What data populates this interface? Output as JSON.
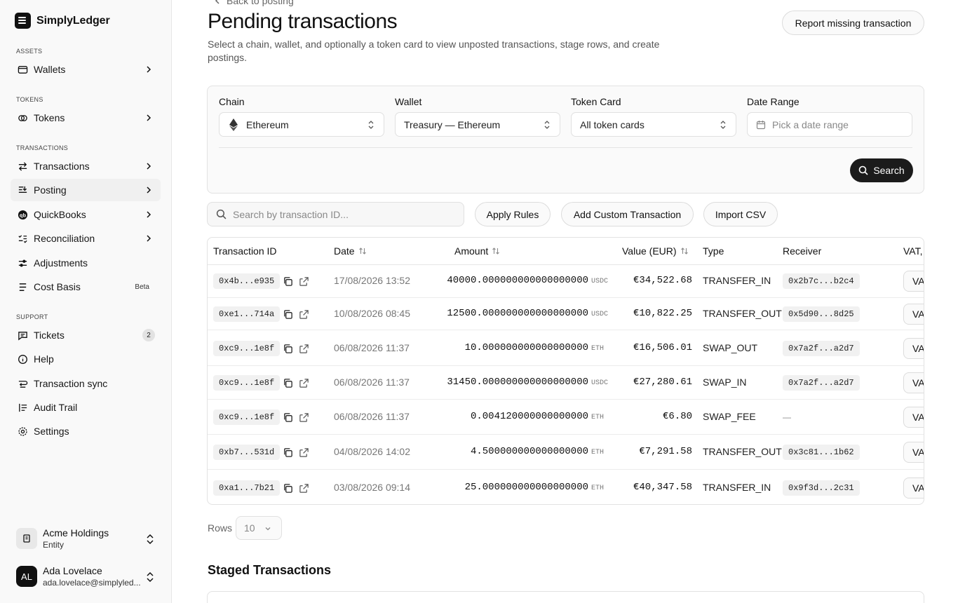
{
  "brand": {
    "name": "SimplyLedger"
  },
  "sidebar": {
    "sections": {
      "assets": "ASSETS",
      "tokens": "TOKENS",
      "transactions": "TRANSACTIONS",
      "support": "SUPPORT"
    },
    "items": {
      "wallets": "Wallets",
      "tokens": "Tokens",
      "transactions": "Transactions",
      "posting": "Posting",
      "quickbooks": "QuickBooks",
      "reconciliation": "Reconciliation",
      "adjustments": "Adjustments",
      "cost_basis": "Cost Basis",
      "cost_basis_badge": "Beta",
      "tickets": "Tickets",
      "tickets_count": "2",
      "help": "Help",
      "transaction_sync": "Transaction sync",
      "audit_trail": "Audit Trail",
      "settings": "Settings"
    },
    "entity": {
      "name": "Acme Holdings",
      "sub": "Entity"
    },
    "user": {
      "initials": "AL",
      "name": "Ada Lovelace",
      "email": "ada.lovelace@simplyled..."
    }
  },
  "header": {
    "back": "Back to posting",
    "title": "Pending transactions",
    "subtitle": "Select a chain, wallet, and optionally a token card to view unposted transactions, stage rows, and create postings.",
    "report_button": "Report missing transaction"
  },
  "filters": {
    "chain_label": "Chain",
    "chain_value": "Ethereum",
    "wallet_label": "Wallet",
    "wallet_value": "Treasury — Ethereum",
    "token_label": "Token Card",
    "token_value": "All token cards",
    "date_label": "Date Range",
    "date_placeholder": "Pick a date range",
    "search_button": "Search"
  },
  "toolbar": {
    "search_placeholder": "Search by transaction ID...",
    "apply_rules": "Apply Rules",
    "add_custom": "Add Custom Transaction",
    "import_csv": "Import CSV"
  },
  "table": {
    "headers": {
      "txid": "Transaction ID",
      "date": "Date",
      "amount": "Amount",
      "value": "Value (EUR)",
      "type": "Type",
      "receiver": "Receiver",
      "vat": "VAT,"
    },
    "rows": [
      {
        "txid": "0x4b...e935",
        "date": "17/08/2026 13:52",
        "amount": "40000.000000000000000000",
        "unit": "USDC",
        "value": "€34,522.68",
        "type": "TRANSFER_IN",
        "receiver": "0x2b7c...b2c4",
        "vat": "VA"
      },
      {
        "txid": "0xe1...714a",
        "date": "10/08/2026 08:45",
        "amount": "12500.000000000000000000",
        "unit": "USDC",
        "value": "€10,822.25",
        "type": "TRANSFER_OUT",
        "receiver": "0x5d90...8d25",
        "vat": "VA"
      },
      {
        "txid": "0xc9...1e8f",
        "date": "06/08/2026 11:37",
        "amount": "10.000000000000000000",
        "unit": "ETH",
        "value": "€16,506.01",
        "type": "SWAP_OUT",
        "receiver": "0x7a2f...a2d7",
        "vat": "VA"
      },
      {
        "txid": "0xc9...1e8f",
        "date": "06/08/2026 11:37",
        "amount": "31450.000000000000000000",
        "unit": "USDC",
        "value": "€27,280.61",
        "type": "SWAP_IN",
        "receiver": "0x7a2f...a2d7",
        "vat": "VA"
      },
      {
        "txid": "0xc9...1e8f",
        "date": "06/08/2026 11:37",
        "amount": "0.004120000000000000",
        "unit": "ETH",
        "value": "€6.80",
        "type": "SWAP_FEE",
        "receiver": "—",
        "vat": "VA"
      },
      {
        "txid": "0xb7...531d",
        "date": "04/08/2026 14:02",
        "amount": "4.500000000000000000",
        "unit": "ETH",
        "value": "€7,291.58",
        "type": "TRANSFER_OUT",
        "receiver": "0x3c81...1b62",
        "vat": "VA"
      },
      {
        "txid": "0xa1...7b21",
        "date": "03/08/2026 09:14",
        "amount": "25.000000000000000000",
        "unit": "ETH",
        "value": "€40,347.58",
        "type": "TRANSFER_IN",
        "receiver": "0x9f3d...2c31",
        "vat": "VA"
      }
    ]
  },
  "pagination": {
    "rows_label": "Rows",
    "rows_value": "10"
  },
  "staged": {
    "title": "Staged Transactions"
  }
}
